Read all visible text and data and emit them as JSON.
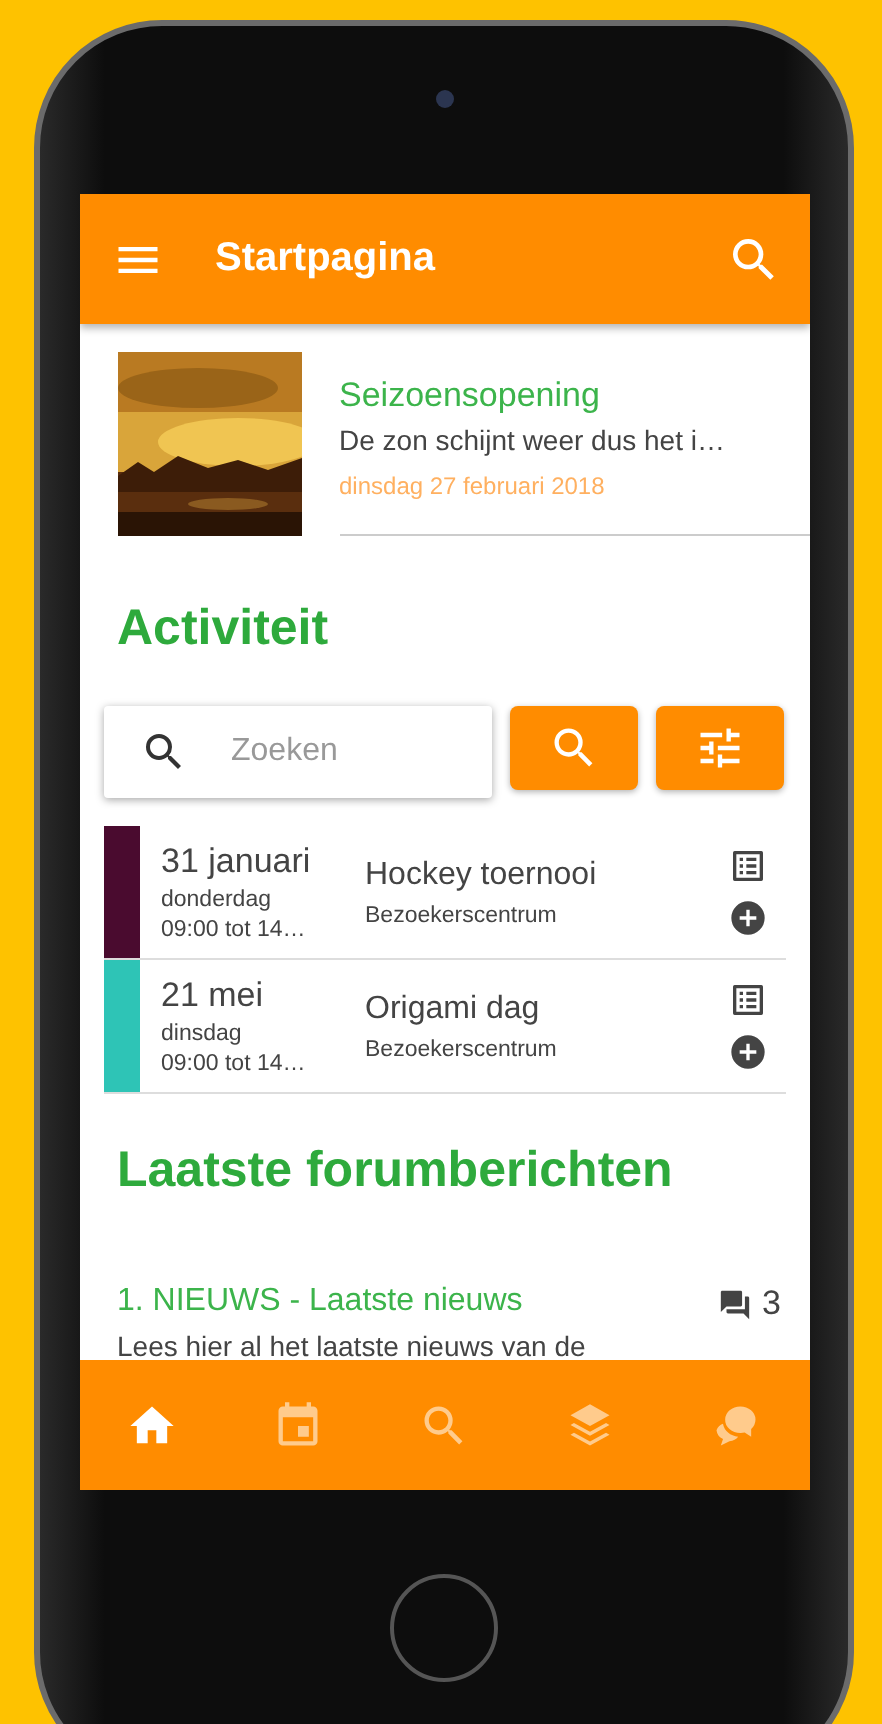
{
  "header": {
    "title": "Startpagina"
  },
  "news": [
    {
      "title": "Seizoensopening",
      "excerpt": "De zon schijnt weer dus het i…",
      "date": "dinsdag 27 februari 2018"
    }
  ],
  "activity": {
    "heading": "Activiteit",
    "search": {
      "placeholder": "Zoeken"
    },
    "events": [
      {
        "date": "31 januari",
        "weekday": "donderdag",
        "time": "09:00 tot 14…",
        "title": "Hockey toernooi",
        "location": "Bezoekerscentrum",
        "color": "#4a0b2f"
      },
      {
        "date": "21 mei",
        "weekday": "dinsdag",
        "time": "09:00 tot 14…",
        "title": "Origami dag",
        "location": "Bezoekerscentrum",
        "color": "#2ec4b6"
      }
    ]
  },
  "forum": {
    "heading": "Laatste forumberichten",
    "topics": [
      {
        "title": "1. NIEUWS - Laatste nieuws",
        "count": "3",
        "excerpt": "Lees hier al het laatste nieuws van de"
      }
    ]
  },
  "bottom_nav": [
    {
      "kind": "home",
      "selected": true
    },
    {
      "kind": "calendar",
      "selected": false
    },
    {
      "kind": "search",
      "selected": false
    },
    {
      "kind": "layers",
      "selected": false
    },
    {
      "kind": "chat",
      "selected": false
    }
  ]
}
